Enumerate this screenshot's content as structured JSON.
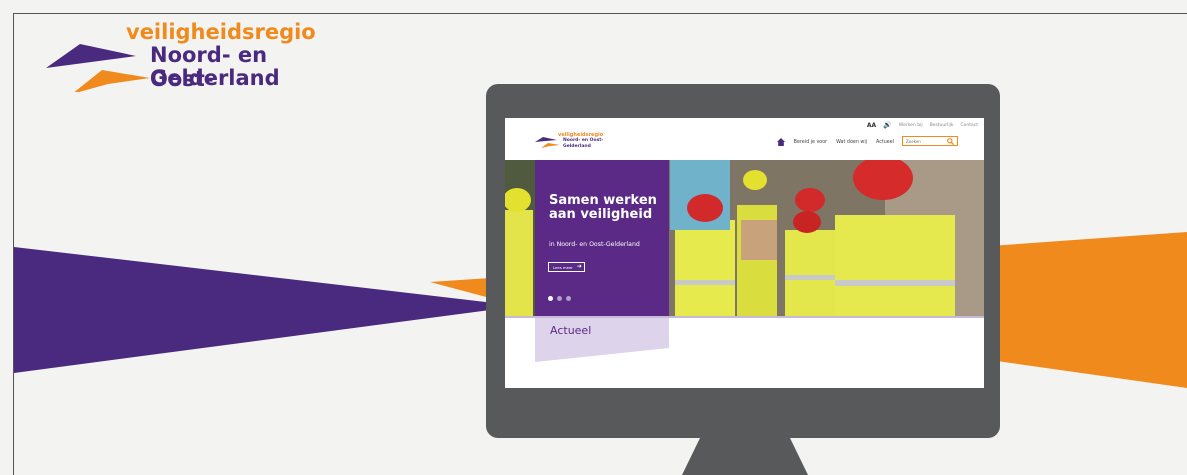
{
  "colors": {
    "orange": "#f08a1d",
    "purple": "#4a2a7e",
    "panel_purple": "#5b2a86",
    "monitor_gray": "#58595b",
    "background": "#f3f3f2"
  },
  "brand": {
    "line1": "veiligheidsregio",
    "line2": "Noord- en Oost-",
    "line3": "Gelderland"
  },
  "screen": {
    "logo": {
      "line1": "veiligheidsregio",
      "line2": "Noord- en Oost-",
      "line3": "Gelderland"
    },
    "utility": {
      "text_size": "AA",
      "speaker_icon": "speaker-icon",
      "links": [
        "Werken bij",
        "Bestuurlijk",
        "Contact"
      ]
    },
    "nav": {
      "home_icon": "home-icon",
      "items": [
        "Bereid je voor",
        "Wat doen wij",
        "Actueel"
      ]
    },
    "search": {
      "placeholder": "Zoeken",
      "icon": "search-icon"
    },
    "hero": {
      "title": "Samen werken aan veiligheid",
      "subtitle": "in Noord- en Oost-Gelderland",
      "button": "Lees meer",
      "slides": 3,
      "active_slide": 1
    },
    "section_title": "Actueel"
  }
}
